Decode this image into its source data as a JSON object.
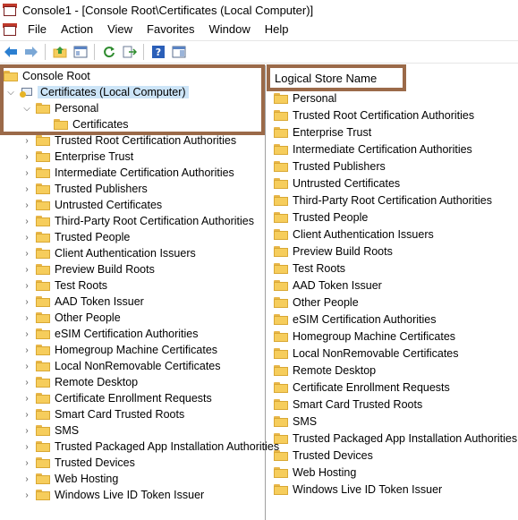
{
  "window": {
    "title": "Console1 - [Console Root\\Certificates (Local Computer)]"
  },
  "menu": [
    "File",
    "Action",
    "View",
    "Favorites",
    "Window",
    "Help"
  ],
  "tree": {
    "root": "Console Root",
    "computer": "Certificates (Local Computer)",
    "personal": "Personal",
    "personal_child": "Certificates",
    "items": [
      "Trusted Root Certification Authorities",
      "Enterprise Trust",
      "Intermediate Certification Authorities",
      "Trusted Publishers",
      "Untrusted Certificates",
      "Third-Party Root Certification Authorities",
      "Trusted People",
      "Client Authentication Issuers",
      "Preview Build Roots",
      "Test Roots",
      "AAD Token Issuer",
      "Other People",
      "eSIM Certification Authorities",
      "Homegroup Machine Certificates",
      "Local NonRemovable Certificates",
      "Remote Desktop",
      "Certificate Enrollment Requests",
      "Smart Card Trusted Roots",
      "SMS",
      "Trusted Packaged App Installation Authorities",
      "Trusted Devices",
      "Web Hosting",
      "Windows Live ID Token Issuer"
    ]
  },
  "list": {
    "header": "Logical Store Name",
    "items": [
      "Personal",
      "Trusted Root Certification Authorities",
      "Enterprise Trust",
      "Intermediate Certification Authorities",
      "Trusted Publishers",
      "Untrusted Certificates",
      "Third-Party Root Certification Authorities",
      "Trusted People",
      "Client Authentication Issuers",
      "Preview Build Roots",
      "Test Roots",
      "AAD Token Issuer",
      "Other People",
      "eSIM Certification Authorities",
      "Homegroup Machine Certificates",
      "Local NonRemovable Certificates",
      "Remote Desktop",
      "Certificate Enrollment Requests",
      "Smart Card Trusted Roots",
      "SMS",
      "Trusted Packaged App Installation Authorities",
      "Trusted Devices",
      "Web Hosting",
      "Windows Live ID Token Issuer"
    ]
  },
  "colors": {
    "highlight_border": "#9b6a49",
    "selection": "#cce4f7",
    "folder": "#f6cd5c"
  }
}
